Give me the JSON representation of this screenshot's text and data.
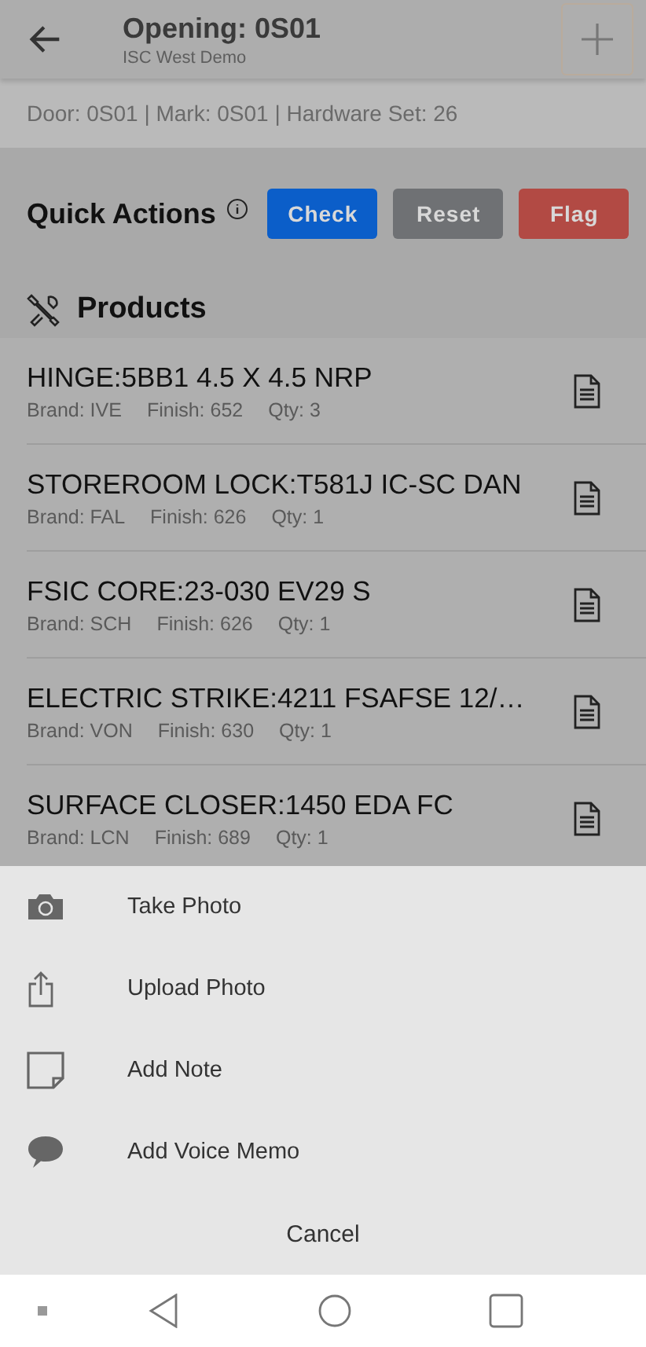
{
  "header": {
    "title": "Opening: 0S01",
    "subtitle": "ISC West Demo"
  },
  "info": "Door: 0S01 | Mark: 0S01 | Hardware Set: 26",
  "quick_actions": {
    "title": "Quick Actions",
    "buttons": [
      {
        "label": "Check",
        "color": "#0b5ec9"
      },
      {
        "label": "Reset",
        "color": "#6f7174"
      },
      {
        "label": "Flag",
        "color": "#b24a44"
      }
    ]
  },
  "products": {
    "title": "Products",
    "items": [
      {
        "name": "HINGE:5BB1 4.5 X 4.5 NRP",
        "brand": "Brand: IVE",
        "finish": "Finish: 652",
        "qty": "Qty: 3"
      },
      {
        "name": "STOREROOM LOCK:T581J IC-SC DAN",
        "brand": "Brand: FAL",
        "finish": "Finish: 626",
        "qty": "Qty: 1"
      },
      {
        "name": "FSIC CORE:23-030 EV29 S",
        "brand": "Brand: SCH",
        "finish": "Finish: 626",
        "qty": "Qty: 1"
      },
      {
        "name": "ELECTRIC STRIKE:4211 FSAFSE 12/…",
        "brand": "Brand: VON",
        "finish": "Finish: 630",
        "qty": "Qty: 1"
      },
      {
        "name": "SURFACE CLOSER:1450 EDA FC",
        "brand": "Brand: LCN",
        "finish": "Finish: 689",
        "qty": "Qty: 1"
      }
    ]
  },
  "action_sheet": {
    "items": [
      "Take Photo",
      "Upload Photo",
      "Add Note",
      "Add Voice Memo"
    ],
    "cancel": "Cancel"
  }
}
